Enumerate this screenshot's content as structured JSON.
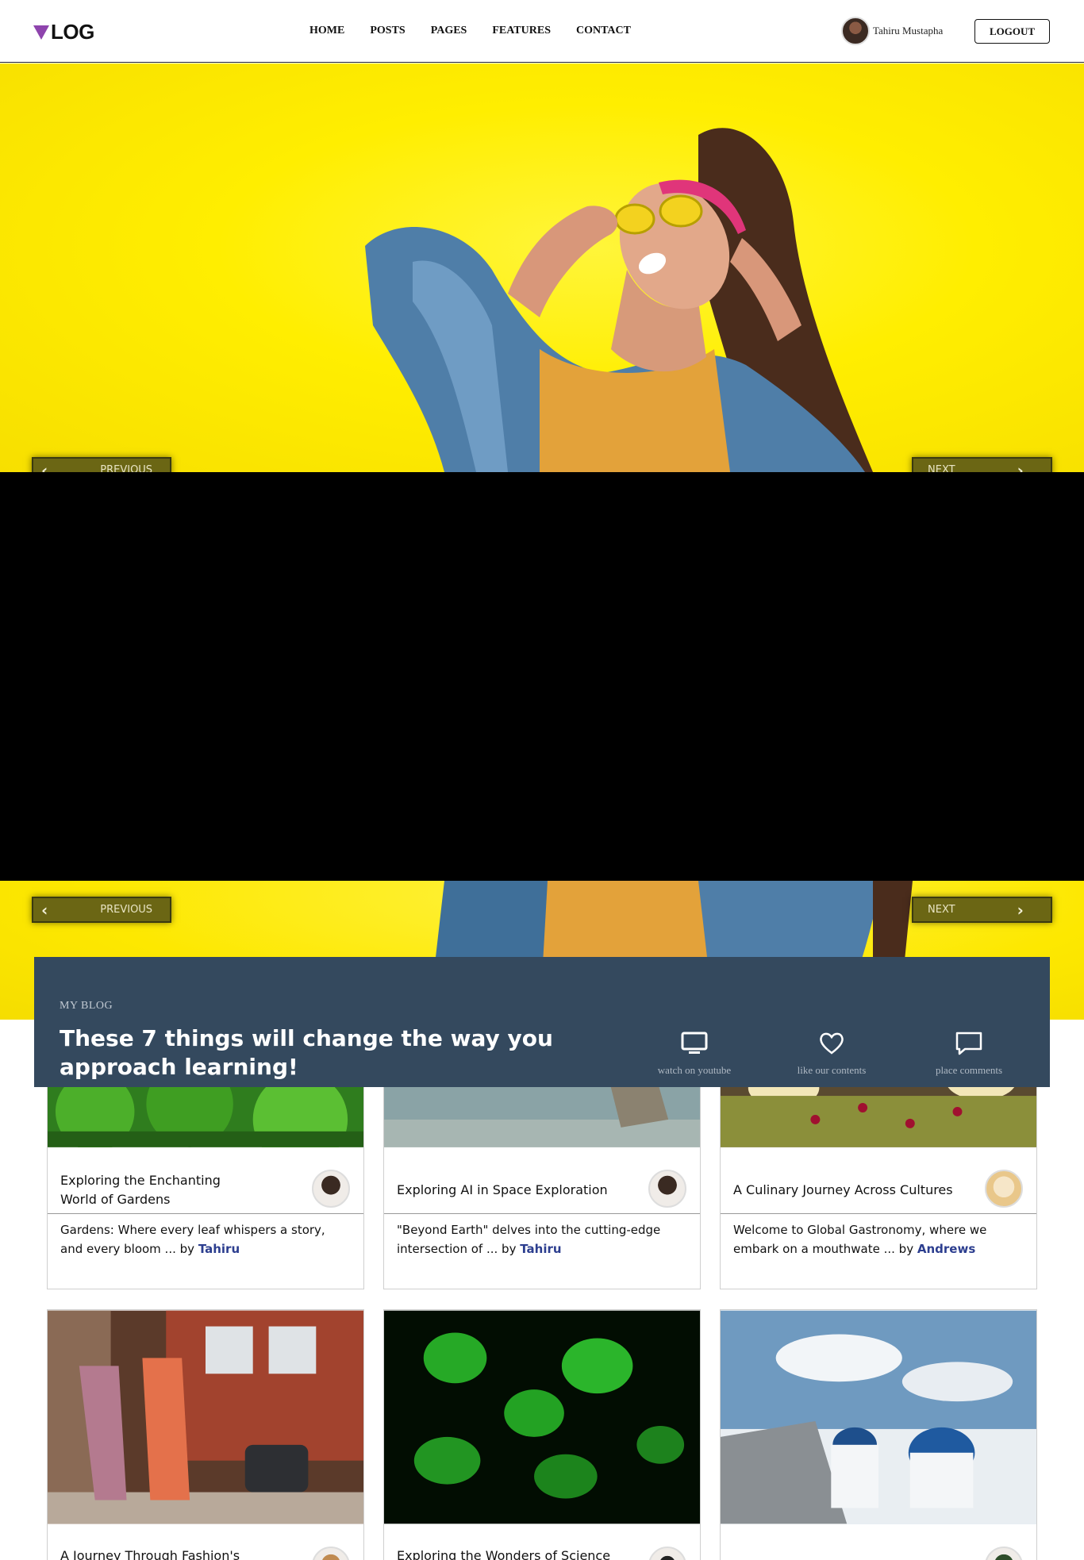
{
  "brand": {
    "logo_text": "LOG",
    "accent": "#8e44ad"
  },
  "nav": {
    "items": [
      "HOME",
      "POSTS",
      "PAGES",
      "FEATURES",
      "CONTACT"
    ]
  },
  "user": {
    "name": "Tahiru Mustapha",
    "logout_label": "LOGOUT"
  },
  "slider": {
    "prev_label": "PREVIOUS",
    "next_label": "NEXT"
  },
  "banner": {
    "tag": "MY BLOG",
    "title": "These 7 things will change the way you approach learning!",
    "actions": [
      {
        "icon": "monitor-icon",
        "label": "watch on youtube"
      },
      {
        "icon": "heart-icon",
        "label": "like our contents"
      },
      {
        "icon": "comment-icon",
        "label": "place comments"
      }
    ],
    "background": "#34495e"
  },
  "posts": [
    {
      "title": "Exploring the Enchanting World of Gardens",
      "excerpt": "Gardens: Where every leaf whispers a story, and every bloom ... by",
      "author": "Tahiru"
    },
    {
      "title": "Exploring AI in Space Exploration",
      "excerpt": "\"Beyond Earth\" delves into the cutting-edge intersection of ... by",
      "author": "Tahiru"
    },
    {
      "title": "A Culinary Journey Across Cultures",
      "excerpt": "Welcome to Global Gastronomy, where we embark on a mouthwate ... by",
      "author": "Andrews"
    },
    {
      "title": "A Journey Through Fashion's Timeless"
    },
    {
      "title": "Exploring the Wonders of Science and"
    },
    {
      "title": ""
    }
  ]
}
